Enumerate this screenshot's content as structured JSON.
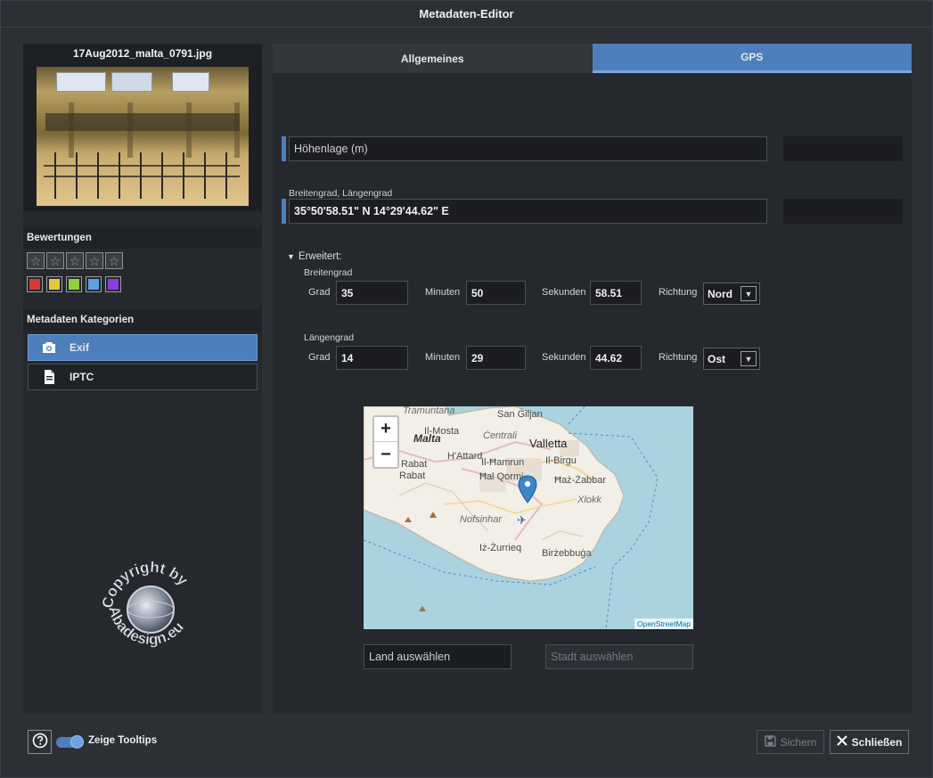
{
  "window": {
    "title": "Metadaten-Editor"
  },
  "left": {
    "file_name": "17Aug2012_malta_0791.jpg",
    "ratings_title": "Bewertungen",
    "stars": [
      "☆",
      "☆",
      "☆",
      "☆",
      "☆"
    ],
    "color_labels": [
      "#d43a2f",
      "#e3c83a",
      "#8fd13c",
      "#5aa1e8",
      "#8a3ee0"
    ],
    "categories_title": "Metadaten Kategorien",
    "categories": [
      {
        "label": "Exif",
        "icon": "camera-icon",
        "active": true
      },
      {
        "label": "IPTC",
        "icon": "document-icon",
        "active": false
      }
    ],
    "watermark": {
      "top": "Copyright by",
      "bottom": "Abadesign.eu"
    }
  },
  "tabs": [
    {
      "label": "Allgemeines",
      "active": false
    },
    {
      "label": "GPS",
      "active": true
    }
  ],
  "gps": {
    "altitude_placeholder": "Höhenlage (m)",
    "coords_label": "Breitengrad, Längengrad",
    "coords_value": "35°50'58.51\" N 14°29'44.62\" E",
    "advanced_label": "Erweitert:",
    "latitude": {
      "title": "Breitengrad",
      "deg_label": "Grad",
      "deg": "35",
      "min_label": "Minuten",
      "min": "50",
      "sec_label": "Sekunden",
      "sec": "58.51",
      "dir_label": "Richtung",
      "dir": "Nord"
    },
    "longitude": {
      "title": "Längengrad",
      "deg_label": "Grad",
      "deg": "14",
      "min_label": "Minuten",
      "min": "29",
      "sec_label": "Sekunden",
      "sec": "44.62",
      "dir_label": "Richtung",
      "dir": "Ost"
    },
    "map": {
      "zoom_in": "+",
      "zoom_out": "−",
      "attribution": "OpenStreetMap",
      "places": [
        "Tramuntana",
        "San Ġiljan",
        "Il-Mosta",
        "Malta",
        "Ċentrali",
        "Valletta",
        "H'Attard",
        "Il-Birgu",
        "Rabat",
        "Rabat",
        "Il-Ħamrun",
        "Ħal Qormi",
        "Ħaż-Żabbar",
        "Xlokk",
        "Nofsinhar",
        "Iż-Żurrieq",
        "Birżebbuġa"
      ]
    },
    "country_placeholder": "Land auswählen",
    "city_placeholder": "Stadt auswählen"
  },
  "footer": {
    "help_icon": "question-icon",
    "tooltips_label": "Zeige Tooltips",
    "tooltips_on": true,
    "save_label": "Sichern",
    "close_label": "Schließen"
  }
}
